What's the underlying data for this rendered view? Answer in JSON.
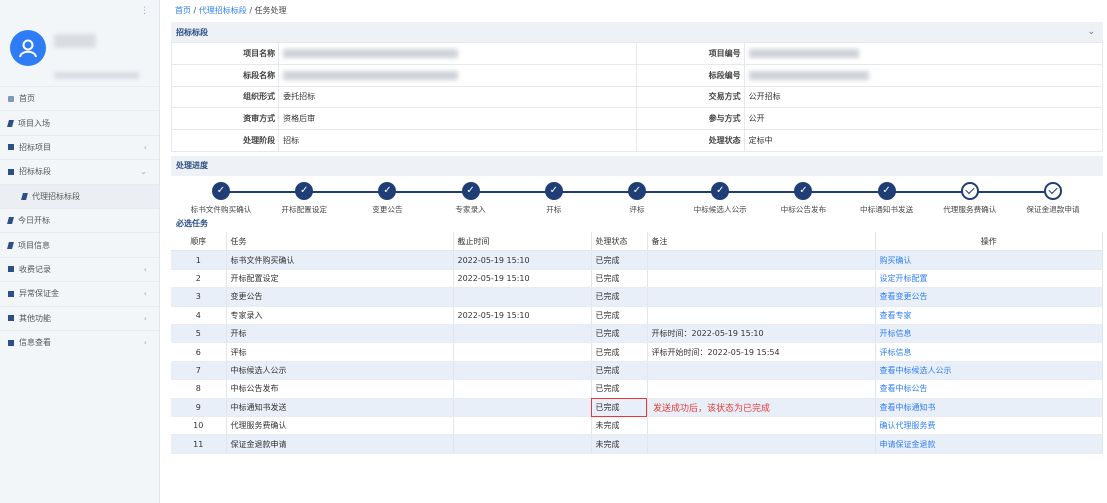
{
  "breadcrumb": {
    "home": "首页",
    "sep1": " / ",
    "parent": "代理招标标段",
    "sep2": " / ",
    "current": "任务处理"
  },
  "sidebar": {
    "collapse_glyph": "⋮",
    "items": [
      {
        "label": "首页",
        "icon": "home-icon",
        "arrow": ""
      },
      {
        "label": "项目入场",
        "icon": "bookmark-icon",
        "arrow": ""
      },
      {
        "label": "招标项目",
        "icon": "square-icon",
        "arrow": "‹"
      },
      {
        "label": "招标标段",
        "icon": "square-icon",
        "arrow": "⌄"
      },
      {
        "label": "代理招标标段",
        "icon": "bookmark-icon",
        "arrow": "",
        "sub": true
      },
      {
        "label": "今日开标",
        "icon": "bookmark-icon",
        "arrow": ""
      },
      {
        "label": "项目信息",
        "icon": "bookmark-icon",
        "arrow": ""
      },
      {
        "label": "收费记录",
        "icon": "square-icon",
        "arrow": "‹"
      },
      {
        "label": "异常保证金",
        "icon": "square-icon",
        "arrow": "‹"
      },
      {
        "label": "其他功能",
        "icon": "square-icon",
        "arrow": "‹"
      },
      {
        "label": "信息查看",
        "icon": "square-icon",
        "arrow": "‹"
      }
    ]
  },
  "section_titles": {
    "info": "招标标段",
    "progress": "处理进度",
    "tasks": "必选任务"
  },
  "info": {
    "rows": [
      {
        "l1": "项目名称",
        "v1": "",
        "l2": "项目编号",
        "v2": ""
      },
      {
        "l1": "标段名称",
        "v1": "",
        "l2": "标段编号",
        "v2": ""
      },
      {
        "l1": "组织形式",
        "v1": "委托招标",
        "l2": "交易方式",
        "v2": "公开招标"
      },
      {
        "l1": "资审方式",
        "v1": "资格后审",
        "l2": "参与方式",
        "v2": "公开"
      },
      {
        "l1": "处理阶段",
        "v1": "招标",
        "l2": "处理状态",
        "v2": "定标中"
      }
    ]
  },
  "progress": {
    "steps": [
      {
        "label": "标书文件购买确认",
        "done": true
      },
      {
        "label": "开标配置设定",
        "done": true
      },
      {
        "label": "变更公告",
        "done": true
      },
      {
        "label": "专家录入",
        "done": true
      },
      {
        "label": "开标",
        "done": true
      },
      {
        "label": "评标",
        "done": true
      },
      {
        "label": "中标候选人公示",
        "done": true
      },
      {
        "label": "中标公告发布",
        "done": true
      },
      {
        "label": "中标通知书发送",
        "done": true
      },
      {
        "label": "代理服务费确认",
        "done": false
      },
      {
        "label": "保证金退款申请",
        "done": false
      }
    ]
  },
  "tasks": {
    "headers": {
      "seq": "顺序",
      "task": "任务",
      "deadline": "截止时间",
      "status": "处理状态",
      "note": "备注",
      "op": "操作"
    },
    "rows": [
      {
        "seq": "1",
        "task": "标书文件购买确认",
        "deadline": "2022-05-19 15:10",
        "status": "已完成",
        "note": "",
        "op": "购买确认"
      },
      {
        "seq": "2",
        "task": "开标配置设定",
        "deadline": "2022-05-19 15:10",
        "status": "已完成",
        "note": "",
        "op": "设定开标配置"
      },
      {
        "seq": "3",
        "task": "变更公告",
        "deadline": "",
        "status": "已完成",
        "note": "",
        "op": "查看变更公告"
      },
      {
        "seq": "4",
        "task": "专家录入",
        "deadline": "2022-05-19 15:10",
        "status": "已完成",
        "note": "",
        "op": "查看专家"
      },
      {
        "seq": "5",
        "task": "开标",
        "deadline": "",
        "status": "已完成",
        "note": "开标时间：2022-05-19 15:10",
        "op": "开标信息"
      },
      {
        "seq": "6",
        "task": "评标",
        "deadline": "",
        "status": "已完成",
        "note": "评标开始时间：2022-05-19 15:54",
        "op": "评标信息"
      },
      {
        "seq": "7",
        "task": "中标候选人公示",
        "deadline": "",
        "status": "已完成",
        "note": "",
        "op": "查看中标候选人公示"
      },
      {
        "seq": "8",
        "task": "中标公告发布",
        "deadline": "",
        "status": "已完成",
        "note": "",
        "op": "查看中标公告"
      },
      {
        "seq": "9",
        "task": "中标通知书发送",
        "deadline": "",
        "status": "已完成",
        "note": "",
        "op": "查看中标通知书"
      },
      {
        "seq": "10",
        "task": "代理服务费确认",
        "deadline": "",
        "status": "未完成",
        "note": "",
        "op": "确认代理服务费"
      },
      {
        "seq": "11",
        "task": "保证金退款申请",
        "deadline": "",
        "status": "未完成",
        "note": "",
        "op": "申请保证金退款"
      }
    ],
    "annotation": "发送成功后，该状态为已完成"
  },
  "colors": {
    "accent": "#2f7df6",
    "navy": "#1f3e75",
    "annotation": "#e53935"
  }
}
